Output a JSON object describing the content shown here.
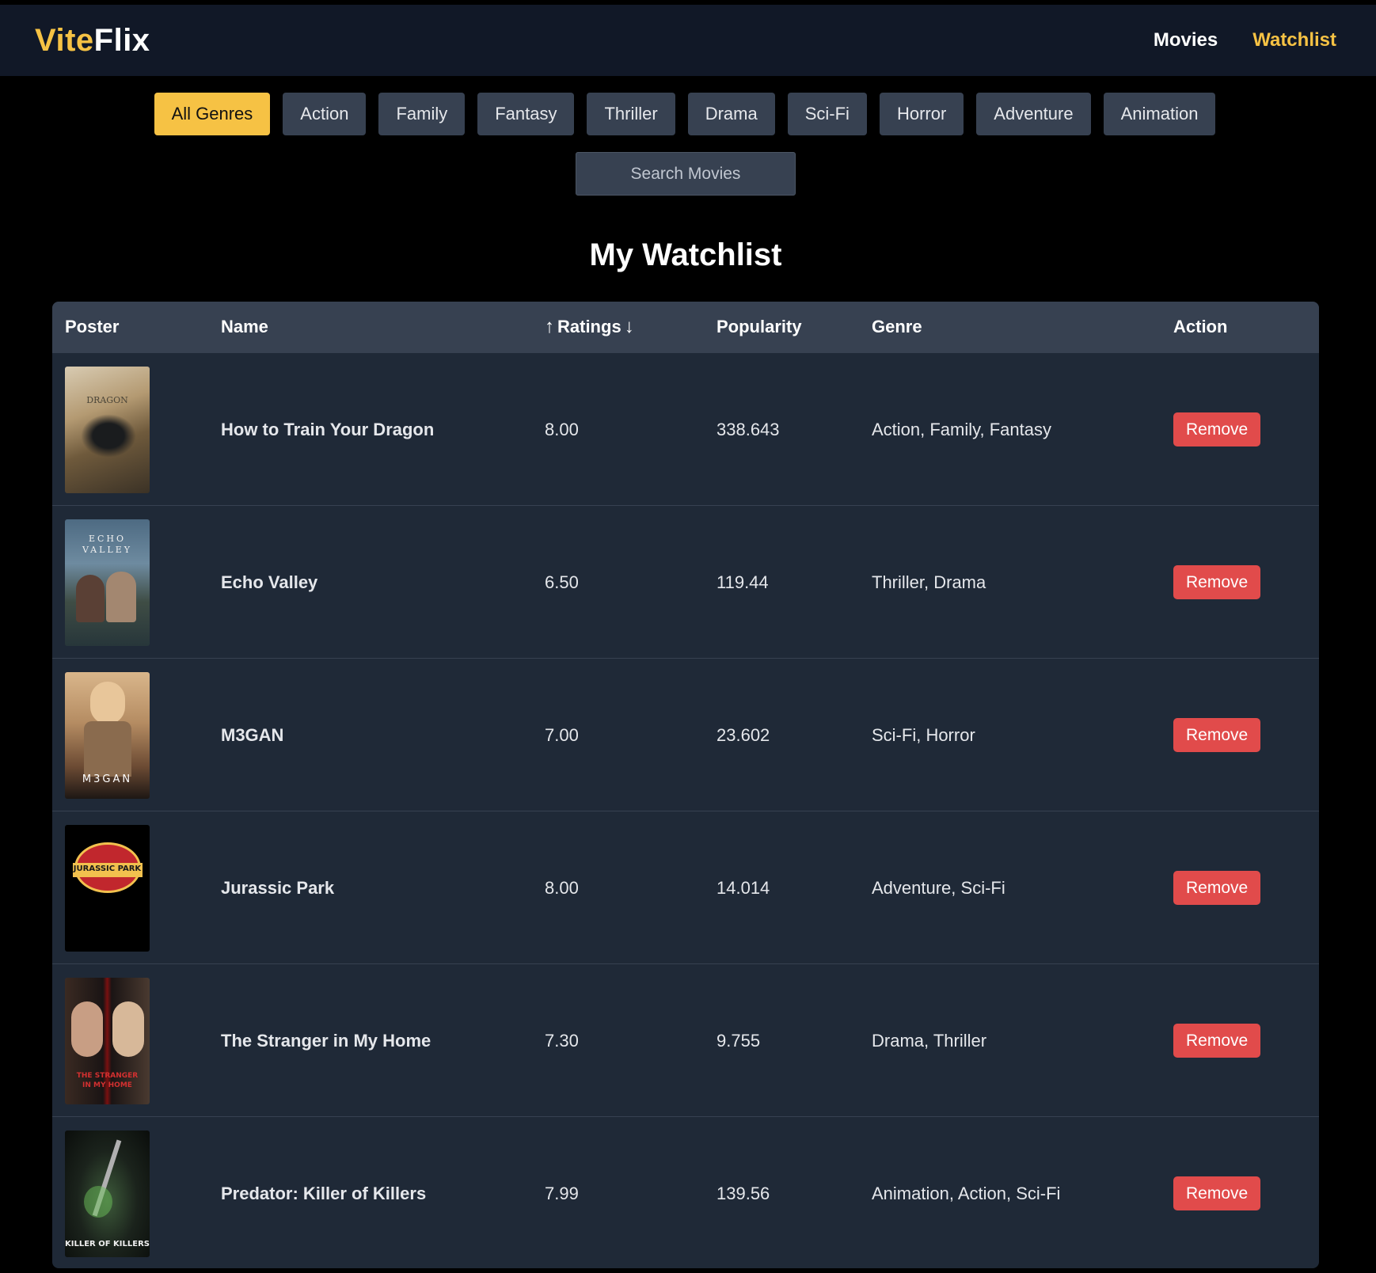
{
  "nav": {
    "logo_part1": "Vite",
    "logo_part2": "Flix",
    "links": [
      "Movies",
      "Watchlist"
    ],
    "active_link": "Watchlist"
  },
  "genres": [
    "All Genres",
    "Action",
    "Family",
    "Fantasy",
    "Thriller",
    "Drama",
    "Sci-Fi",
    "Horror",
    "Adventure",
    "Animation"
  ],
  "active_genre": "All Genres",
  "search": {
    "placeholder": "Search Movies"
  },
  "page_title": "My Watchlist",
  "table": {
    "headers": {
      "poster": "Poster",
      "name": "Name",
      "ratings": "Ratings",
      "popularity": "Popularity",
      "genre": "Genre",
      "action": "Action"
    },
    "rows": [
      {
        "name": "How to Train Your Dragon",
        "rating": "8.00",
        "popularity": "338.643",
        "genre": "Action, Family, Fantasy",
        "action": "Remove",
        "poster_text": "DRAGON"
      },
      {
        "name": "Echo Valley",
        "rating": "6.50",
        "popularity": "119.44",
        "genre": "Thriller, Drama",
        "action": "Remove",
        "poster_text": "ECHO VALLEY"
      },
      {
        "name": "M3GAN",
        "rating": "7.00",
        "popularity": "23.602",
        "genre": "Sci-Fi, Horror",
        "action": "Remove",
        "poster_text": "M3GAN"
      },
      {
        "name": "Jurassic Park",
        "rating": "8.00",
        "popularity": "14.014",
        "genre": "Adventure, Sci-Fi",
        "action": "Remove",
        "poster_text": "JURASSIC PARK"
      },
      {
        "name": "The Stranger in My Home",
        "rating": "7.30",
        "popularity": "9.755",
        "genre": "Drama, Thriller",
        "action": "Remove",
        "poster_text": "THE STRANGER IN MY HOME"
      },
      {
        "name": "Predator: Killer of Killers",
        "rating": "7.99",
        "popularity": "139.56",
        "genre": "Animation, Action, Sci-Fi",
        "action": "Remove",
        "poster_text": "KILLER OF KILLERS"
      }
    ]
  },
  "colors": {
    "accent": "#f6c244",
    "nav_bg": "#111827",
    "table_bg": "#1f2937",
    "header_bg": "#374151",
    "remove": "#e14b4b"
  }
}
